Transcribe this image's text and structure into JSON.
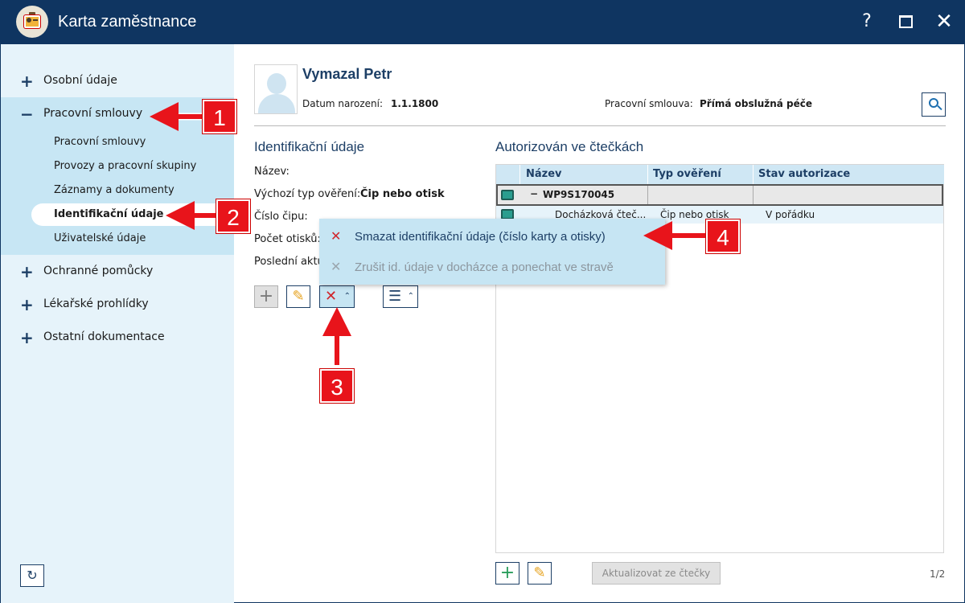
{
  "window": {
    "title": "Karta zaměstnance",
    "help": "?",
    "close": "✕"
  },
  "sidebar": {
    "items": [
      {
        "sign": "+",
        "label": "Osobní údaje"
      },
      {
        "sign": "−",
        "label": "Pracovní smlouvy"
      },
      {
        "sign": "+",
        "label": "Ochranné pomůcky"
      },
      {
        "sign": "+",
        "label": "Lékařské prohlídky"
      },
      {
        "sign": "+",
        "label": "Ostatní dokumentace"
      }
    ],
    "subitems": [
      "Pracovní smlouvy",
      "Provozy a pracovní skupiny",
      "Záznamy a dokumenty",
      "Identifikační údaje",
      "Uživatelské údaje"
    ],
    "refresh_icon": "↻"
  },
  "employee": {
    "name": "Vymazal Petr",
    "birth_label": "Datum narození:",
    "birth_value": "1.1.1800",
    "contract_label": "Pracovní smlouva:",
    "contract_value": "Přímá obslužná péče"
  },
  "ident": {
    "title": "Identifikační údaje",
    "fields": [
      {
        "label": "Název:",
        "value": ""
      },
      {
        "label": "Výchozí typ ověření:",
        "value": "Čip nebo otisk"
      },
      {
        "label": "Číslo čipu:",
        "value": ""
      },
      {
        "label": "Počet otisků:",
        "value": ""
      },
      {
        "label": "Poslední aktu",
        "value": ""
      }
    ],
    "toolbar": {
      "add": "+",
      "edit": "✎",
      "delete": "✕",
      "caret": "⌃",
      "menu": "☰"
    }
  },
  "popup_menu": {
    "items": [
      {
        "icon": "✕",
        "label": "Smazat identifikační údaje (číslo karty a otisky)",
        "enabled": true
      },
      {
        "icon": "✕",
        "label": "Zrušit id. údaje v docházce a ponechat ve stravě",
        "enabled": false
      }
    ]
  },
  "readers": {
    "title": "Autorizován ve čtečkách",
    "columns": [
      "Název",
      "Typ ověření",
      "Stav autorizace"
    ],
    "group_row": {
      "toggle": "−",
      "name": "WP9S170045"
    },
    "rows": [
      {
        "name": "Docházková čteč...",
        "type": "Čip nebo otisk",
        "status": "V pořádku"
      }
    ],
    "toolbar": {
      "add": "+",
      "edit": "✎",
      "update": "Aktualizovat ze čtečky"
    },
    "pager": "1/2"
  },
  "annotations": [
    "1",
    "2",
    "3",
    "4"
  ],
  "colors": {
    "titlebar": "#0f3561",
    "nav_bg": "#e6f3fa",
    "nav_selected": "#c7e6f4",
    "accent_text": "#1d3f66",
    "annotation_red": "#e8141b"
  }
}
